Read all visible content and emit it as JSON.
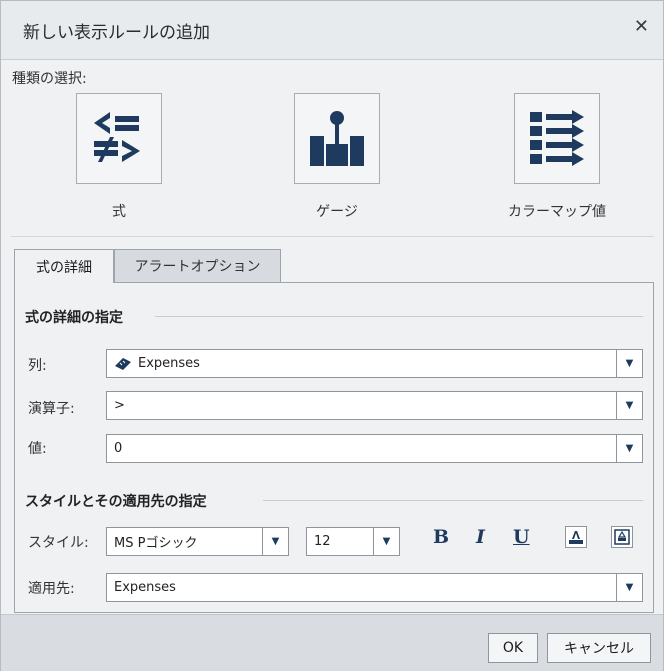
{
  "dialog": {
    "title": "新しい表示ルールの追加",
    "close_label": "✕"
  },
  "type_selection": {
    "label": "種類の選択:",
    "types": [
      {
        "label": "式",
        "icon": "expression-icon"
      },
      {
        "label": "ゲージ",
        "icon": "gauge-icon"
      },
      {
        "label": "カラーマップ値",
        "icon": "colormap-icon"
      }
    ]
  },
  "tabs": [
    {
      "label": "式の詳細",
      "active": true
    },
    {
      "label": "アラートオプション",
      "active": false
    }
  ],
  "expression": {
    "section_title": "式の詳細の指定",
    "column_label": "列:",
    "column_value": "Expenses",
    "operator_label": "演算子:",
    "operator_value": ">",
    "value_label": "値:",
    "value_value": "0"
  },
  "style": {
    "section_title": "スタイルとその適用先の指定",
    "style_label": "スタイル:",
    "font_value": "MS Pゴシック",
    "size_value": "12",
    "bold_label": "B",
    "italic_label": "I",
    "underline_label": "U",
    "apply_label": "適用先:",
    "apply_value": "Expenses"
  },
  "footer": {
    "ok_label": "OK",
    "cancel_label": "キャンセル"
  },
  "colors": {
    "icon_blue": "#1f3a5f",
    "background": "#eff1f3",
    "footer": "#d9dde2"
  }
}
